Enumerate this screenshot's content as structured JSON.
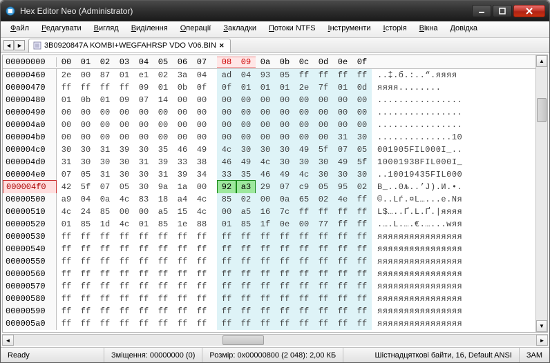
{
  "window": {
    "title": "Hex Editor Neo (Administrator)"
  },
  "menu": {
    "items": [
      "Файл",
      "Редагувати",
      "Вигляд",
      "Виділення",
      "Операції",
      "Закладки",
      "Потоки NTFS",
      "Інструменти",
      "Історія",
      "Вікна",
      "Довідка"
    ]
  },
  "tab": {
    "label": "3B0920847A  KOMBI+WEGFAHRSP VDO V06.BIN"
  },
  "hex": {
    "header_addr": "00000000",
    "columns": [
      "00",
      "01",
      "02",
      "03",
      "04",
      "05",
      "06",
      "07",
      "08",
      "09",
      "0a",
      "0b",
      "0c",
      "0d",
      "0e",
      "0f"
    ],
    "highlight_cols": [
      8,
      9
    ],
    "rows": [
      {
        "addr": "00000460",
        "bytes": [
          "2e",
          "00",
          "87",
          "01",
          "e1",
          "02",
          "3a",
          "04",
          "ad",
          "04",
          "93",
          "05",
          "ff",
          "ff",
          "ff",
          "ff"
        ],
        "ascii": "..‡.б.:.­.“.яяяя"
      },
      {
        "addr": "00000470",
        "bytes": [
          "ff",
          "ff",
          "ff",
          "ff",
          "09",
          "01",
          "0b",
          "0f",
          "0f",
          "01",
          "01",
          "01",
          "2e",
          "7f",
          "01",
          "0d"
        ],
        "ascii": "яяяя........"
      },
      {
        "addr": "00000480",
        "bytes": [
          "01",
          "0b",
          "01",
          "09",
          "07",
          "14",
          "00",
          "00",
          "00",
          "00",
          "00",
          "00",
          "00",
          "00",
          "00",
          "00"
        ],
        "ascii": "................"
      },
      {
        "addr": "00000490",
        "bytes": [
          "00",
          "00",
          "00",
          "00",
          "00",
          "00",
          "00",
          "00",
          "00",
          "00",
          "00",
          "00",
          "00",
          "00",
          "00",
          "00"
        ],
        "ascii": "................"
      },
      {
        "addr": "000004a0",
        "bytes": [
          "00",
          "00",
          "00",
          "00",
          "00",
          "00",
          "00",
          "00",
          "00",
          "00",
          "00",
          "00",
          "00",
          "00",
          "00",
          "00"
        ],
        "ascii": "................"
      },
      {
        "addr": "000004b0",
        "bytes": [
          "00",
          "00",
          "00",
          "00",
          "00",
          "00",
          "00",
          "00",
          "00",
          "00",
          "00",
          "00",
          "00",
          "00",
          "31",
          "30"
        ],
        "ascii": "..............10"
      },
      {
        "addr": "000004c0",
        "bytes": [
          "30",
          "30",
          "31",
          "39",
          "30",
          "35",
          "46",
          "49",
          "4c",
          "30",
          "30",
          "30",
          "49",
          "5f",
          "07",
          "05"
        ],
        "ascii": "001905FIL000I_.."
      },
      {
        "addr": "000004d0",
        "bytes": [
          "31",
          "30",
          "30",
          "30",
          "31",
          "39",
          "33",
          "38",
          "46",
          "49",
          "4c",
          "30",
          "30",
          "30",
          "49",
          "5f"
        ],
        "ascii": "10001938FIL000I_"
      },
      {
        "addr": "000004e0",
        "bytes": [
          "07",
          "05",
          "31",
          "30",
          "30",
          "31",
          "39",
          "34",
          "33",
          "35",
          "46",
          "49",
          "4c",
          "30",
          "30",
          "30"
        ],
        "ascii": "..10019435FIL000"
      },
      {
        "addr": "000004f0",
        "bytes": [
          "42",
          "5f",
          "07",
          "05",
          "30",
          "9a",
          "1a",
          "00",
          "92",
          "a3",
          "29",
          "07",
          "c9",
          "05",
          "95",
          "02"
        ],
        "ascii": "B_..0љ..’Ј).И.•.",
        "hl_row": true,
        "green": [
          8,
          9
        ]
      },
      {
        "addr": "00000500",
        "bytes": [
          "a9",
          "04",
          "0a",
          "4c",
          "83",
          "18",
          "a4",
          "4c",
          "85",
          "02",
          "00",
          "0a",
          "65",
          "02",
          "4e",
          "ff"
        ],
        "ascii": "©..Lѓ.¤L…...e.Nя"
      },
      {
        "addr": "00000510",
        "bytes": [
          "4c",
          "24",
          "85",
          "00",
          "00",
          "a5",
          "15",
          "4c",
          "00",
          "a5",
          "16",
          "7c",
          "ff",
          "ff",
          "ff",
          "ff"
        ],
        "ascii": "L$…..Ґ.L.Ґ.|яяяя"
      },
      {
        "addr": "00000520",
        "bytes": [
          "01",
          "85",
          "1d",
          "4c",
          "01",
          "85",
          "1e",
          "88",
          "01",
          "85",
          "1f",
          "0e",
          "00",
          "77",
          "ff",
          "ff"
        ],
        "ascii": ".….L.….€.…...wяя"
      },
      {
        "addr": "00000530",
        "bytes": [
          "ff",
          "ff",
          "ff",
          "ff",
          "ff",
          "ff",
          "ff",
          "ff",
          "ff",
          "ff",
          "ff",
          "ff",
          "ff",
          "ff",
          "ff",
          "ff"
        ],
        "ascii": "яяяяяяяяяяяяяяяя"
      },
      {
        "addr": "00000540",
        "bytes": [
          "ff",
          "ff",
          "ff",
          "ff",
          "ff",
          "ff",
          "ff",
          "ff",
          "ff",
          "ff",
          "ff",
          "ff",
          "ff",
          "ff",
          "ff",
          "ff"
        ],
        "ascii": "яяяяяяяяяяяяяяяя"
      },
      {
        "addr": "00000550",
        "bytes": [
          "ff",
          "ff",
          "ff",
          "ff",
          "ff",
          "ff",
          "ff",
          "ff",
          "ff",
          "ff",
          "ff",
          "ff",
          "ff",
          "ff",
          "ff",
          "ff"
        ],
        "ascii": "яяяяяяяяяяяяяяяя"
      },
      {
        "addr": "00000560",
        "bytes": [
          "ff",
          "ff",
          "ff",
          "ff",
          "ff",
          "ff",
          "ff",
          "ff",
          "ff",
          "ff",
          "ff",
          "ff",
          "ff",
          "ff",
          "ff",
          "ff"
        ],
        "ascii": "яяяяяяяяяяяяяяяя"
      },
      {
        "addr": "00000570",
        "bytes": [
          "ff",
          "ff",
          "ff",
          "ff",
          "ff",
          "ff",
          "ff",
          "ff",
          "ff",
          "ff",
          "ff",
          "ff",
          "ff",
          "ff",
          "ff",
          "ff"
        ],
        "ascii": "яяяяяяяяяяяяяяяя"
      },
      {
        "addr": "00000580",
        "bytes": [
          "ff",
          "ff",
          "ff",
          "ff",
          "ff",
          "ff",
          "ff",
          "ff",
          "ff",
          "ff",
          "ff",
          "ff",
          "ff",
          "ff",
          "ff",
          "ff"
        ],
        "ascii": "яяяяяяяяяяяяяяяя"
      },
      {
        "addr": "00000590",
        "bytes": [
          "ff",
          "ff",
          "ff",
          "ff",
          "ff",
          "ff",
          "ff",
          "ff",
          "ff",
          "ff",
          "ff",
          "ff",
          "ff",
          "ff",
          "ff",
          "ff"
        ],
        "ascii": "яяяяяяяяяяяяяяяя"
      },
      {
        "addr": "000005a0",
        "bytes": [
          "ff",
          "ff",
          "ff",
          "ff",
          "ff",
          "ff",
          "ff",
          "ff",
          "ff",
          "ff",
          "ff",
          "ff",
          "ff",
          "ff",
          "ff",
          "ff"
        ],
        "ascii": "яяяяяяяяяяяяяяяя"
      }
    ]
  },
  "status": {
    "ready": "Ready",
    "offset": "Зміщення: 00000000 (0)",
    "size": "Розмір: 0x00000800 (2 048): 2,00 КБ",
    "encoding": "Шістнадцяткові байти, 16, Default ANSI",
    "mode": "ЗАМ"
  }
}
